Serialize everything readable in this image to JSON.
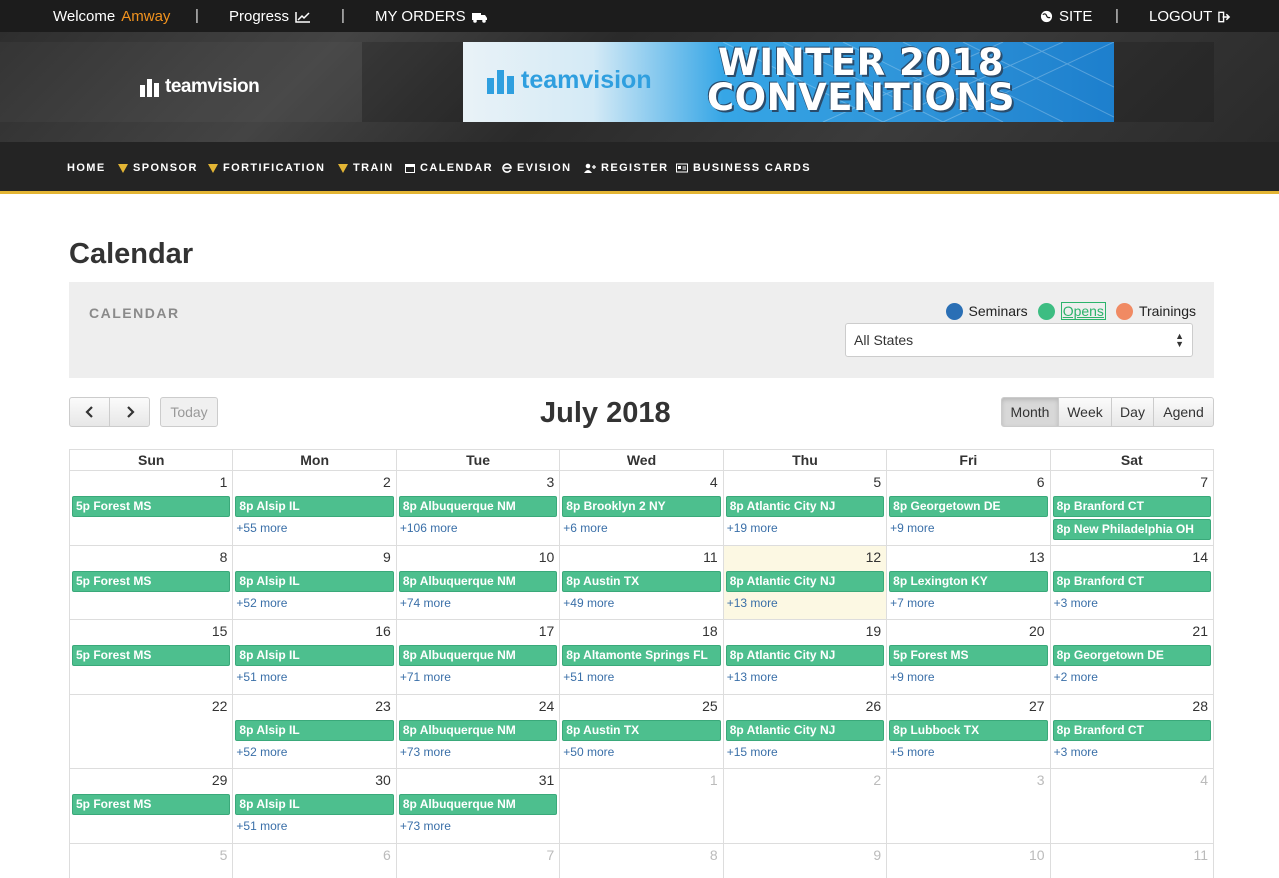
{
  "topbar": {
    "welcome": "Welcome",
    "user": "Amway",
    "progress": "Progress",
    "orders": "MY ORDERS",
    "site": "SITE",
    "logout": "LOGOUT",
    "separator": "|"
  },
  "header": {
    "logo_text": "teamvision",
    "banner_logo": "teamvision",
    "banner_line1": "WINTER 2018",
    "banner_line2": "CONVENTIONS"
  },
  "nav": {
    "home": "HOME",
    "sponsor": "SPONSOR",
    "fortification": "FORTIFICATION",
    "train": "TRAIN",
    "calendar": "CALENDAR",
    "evision": "EVISION",
    "register": "REGISTER",
    "business_cards": "BUSINESS CARDS"
  },
  "page": {
    "title": "Calendar",
    "panel_title": "CALENDAR",
    "legend": {
      "seminars": "Seminars",
      "opens": "Opens",
      "trainings": "Trainings"
    },
    "state_select": "All States",
    "colors": {
      "seminars": "#2a6fb5",
      "opens": "#3dbd82",
      "trainings": "#f08a63",
      "event": "#4dbf8e",
      "accent": "#e3b534"
    }
  },
  "toolbar": {
    "prev": "‹",
    "next": "›",
    "today": "Today",
    "title": "July 2018",
    "month": "Month",
    "week": "Week",
    "day": "Day",
    "agenda": "Agend"
  },
  "calendar": {
    "days_of_week": [
      "Sun",
      "Mon",
      "Tue",
      "Wed",
      "Thu",
      "Fri",
      "Sat"
    ],
    "weeks": [
      [
        {
          "day": "1",
          "events": [
            "5p Forest MS"
          ],
          "more": ""
        },
        {
          "day": "2",
          "events": [
            "8p Alsip IL"
          ],
          "more": "+55 more"
        },
        {
          "day": "3",
          "events": [
            "8p Albuquerque NM"
          ],
          "more": "+106 more"
        },
        {
          "day": "4",
          "events": [
            "8p Brooklyn 2 NY"
          ],
          "more": "+6 more"
        },
        {
          "day": "5",
          "events": [
            "8p Atlantic City NJ"
          ],
          "more": "+19 more"
        },
        {
          "day": "6",
          "events": [
            "8p Georgetown DE"
          ],
          "more": "+9 more"
        },
        {
          "day": "7",
          "events": [
            "8p Branford CT",
            "8p New Philadelphia OH"
          ],
          "more": ""
        }
      ],
      [
        {
          "day": "8",
          "events": [
            "5p Forest MS"
          ],
          "more": ""
        },
        {
          "day": "9",
          "events": [
            "8p Alsip IL"
          ],
          "more": "+52 more"
        },
        {
          "day": "10",
          "events": [
            "8p Albuquerque NM"
          ],
          "more": "+74 more"
        },
        {
          "day": "11",
          "events": [
            "8p Austin TX"
          ],
          "more": "+49 more"
        },
        {
          "day": "12",
          "events": [
            "8p Atlantic City NJ"
          ],
          "more": "+13 more",
          "today": true
        },
        {
          "day": "13",
          "events": [
            "8p Lexington KY"
          ],
          "more": "+7 more"
        },
        {
          "day": "14",
          "events": [
            "8p Branford CT"
          ],
          "more": "+3 more"
        }
      ],
      [
        {
          "day": "15",
          "events": [
            "5p Forest MS"
          ],
          "more": ""
        },
        {
          "day": "16",
          "events": [
            "8p Alsip IL"
          ],
          "more": "+51 more"
        },
        {
          "day": "17",
          "events": [
            "8p Albuquerque NM"
          ],
          "more": "+71 more"
        },
        {
          "day": "18",
          "events": [
            "8p Altamonte Springs FL"
          ],
          "more": "+51 more"
        },
        {
          "day": "19",
          "events": [
            "8p Atlantic City NJ"
          ],
          "more": "+13 more"
        },
        {
          "day": "20",
          "events": [
            "5p Forest MS"
          ],
          "more": "+9 more"
        },
        {
          "day": "21",
          "events": [
            "8p Georgetown DE"
          ],
          "more": "+2 more"
        }
      ],
      [
        {
          "day": "22",
          "events": [],
          "more": ""
        },
        {
          "day": "23",
          "events": [
            "8p Alsip IL"
          ],
          "more": "+52 more"
        },
        {
          "day": "24",
          "events": [
            "8p Albuquerque NM"
          ],
          "more": "+73 more"
        },
        {
          "day": "25",
          "events": [
            "8p Austin TX"
          ],
          "more": "+50 more"
        },
        {
          "day": "26",
          "events": [
            "8p Atlantic City NJ"
          ],
          "more": "+15 more"
        },
        {
          "day": "27",
          "events": [
            "8p Lubbock TX"
          ],
          "more": "+5 more"
        },
        {
          "day": "28",
          "events": [
            "8p Branford CT"
          ],
          "more": "+3 more"
        }
      ],
      [
        {
          "day": "29",
          "events": [
            "5p Forest MS"
          ],
          "more": ""
        },
        {
          "day": "30",
          "events": [
            "8p Alsip IL"
          ],
          "more": "+51 more"
        },
        {
          "day": "31",
          "events": [
            "8p Albuquerque NM"
          ],
          "more": "+73 more"
        },
        {
          "day": "1",
          "events": [],
          "more": "",
          "other": true
        },
        {
          "day": "2",
          "events": [],
          "more": "",
          "other": true
        },
        {
          "day": "3",
          "events": [],
          "more": "",
          "other": true
        },
        {
          "day": "4",
          "events": [],
          "more": "",
          "other": true
        }
      ],
      [
        {
          "day": "5",
          "events": [],
          "more": "",
          "other": true
        },
        {
          "day": "6",
          "events": [],
          "more": "",
          "other": true
        },
        {
          "day": "7",
          "events": [],
          "more": "",
          "other": true
        },
        {
          "day": "8",
          "events": [],
          "more": "",
          "other": true
        },
        {
          "day": "9",
          "events": [],
          "more": "",
          "other": true
        },
        {
          "day": "10",
          "events": [],
          "more": "",
          "other": true
        },
        {
          "day": "11",
          "events": [],
          "more": "",
          "other": true
        }
      ]
    ]
  }
}
